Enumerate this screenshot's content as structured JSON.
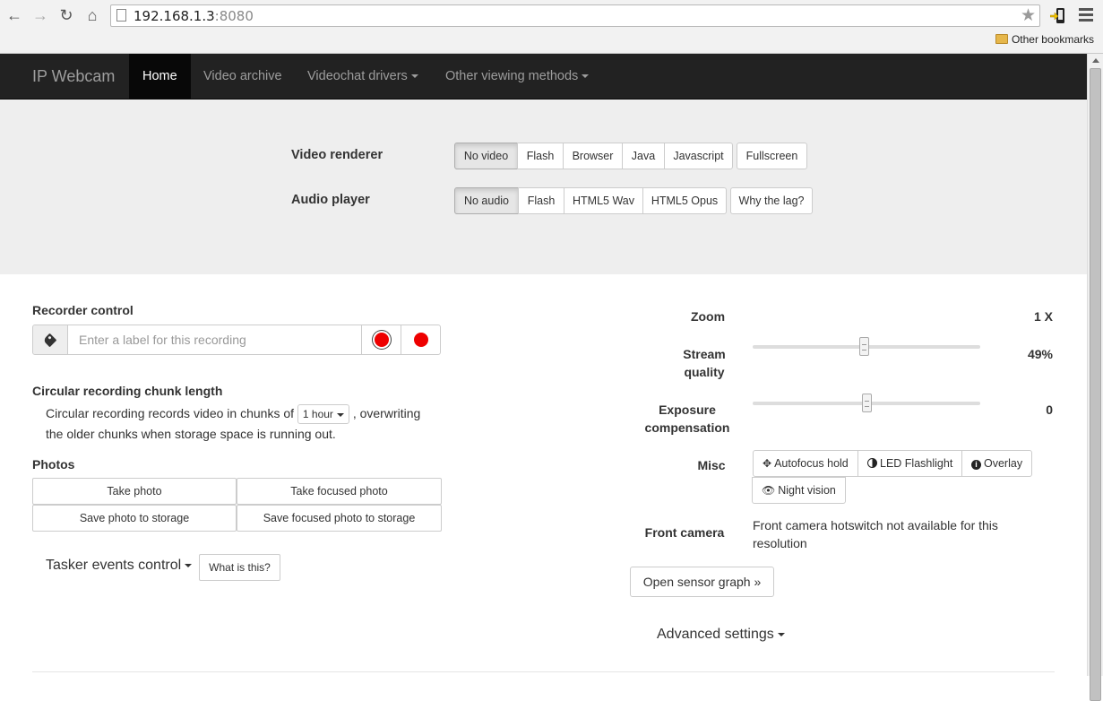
{
  "browser": {
    "url_host": "192.168.1.3",
    "url_port": ":8080",
    "bookmarks_label": "Other bookmarks"
  },
  "navbar": {
    "brand": "IP Webcam",
    "items": [
      {
        "label": "Home",
        "active": true
      },
      {
        "label": "Video archive"
      },
      {
        "label": "Videochat drivers"
      },
      {
        "label": "Other viewing methods"
      }
    ]
  },
  "video_renderer": {
    "label": "Video renderer",
    "options": [
      "No video",
      "Flash",
      "Browser",
      "Java",
      "Javascript"
    ],
    "selected": "No video",
    "fullscreen": "Fullscreen"
  },
  "audio_player": {
    "label": "Audio player",
    "options": [
      "No audio",
      "Flash",
      "HTML5 Wav",
      "HTML5 Opus"
    ],
    "selected": "No audio",
    "why_lag": "Why the lag?"
  },
  "recorder": {
    "title": "Recorder control",
    "placeholder": "Enter a label for this recording"
  },
  "circular": {
    "title": "Circular recording chunk length",
    "text_before": "Circular recording records video in chunks of",
    "chunk_value": "1 hour",
    "text_after": ", overwriting",
    "text_line2": "the older chunks when storage space is running out."
  },
  "photos": {
    "title": "Photos",
    "take_photo": "Take photo",
    "take_focused": "Take focused photo",
    "save_photo": "Save photo to storage",
    "save_focused": "Save focused photo to storage"
  },
  "tasker": {
    "label": "Tasker events control",
    "what": "What is this?"
  },
  "controls": {
    "zoom_label": "Zoom",
    "zoom_value": "1 X",
    "quality_label_1": "Stream",
    "quality_label_2": "quality",
    "quality_value": "49%",
    "quality_fraction": 0.49,
    "exposure_label_1": "Exposure",
    "exposure_label_2": "compensation",
    "exposure_value": "0",
    "exposure_fraction": 0.5,
    "misc_label": "Misc",
    "autofocus": "Autofocus hold",
    "led": "LED Flashlight",
    "overlay": "Overlay",
    "night": "Night vision",
    "front_label": "Front camera",
    "front_text_1": "Front camera hotswitch not available for this",
    "front_text_2": "resolution",
    "sensor_graph": "Open sensor graph »",
    "advanced": "Advanced settings"
  }
}
